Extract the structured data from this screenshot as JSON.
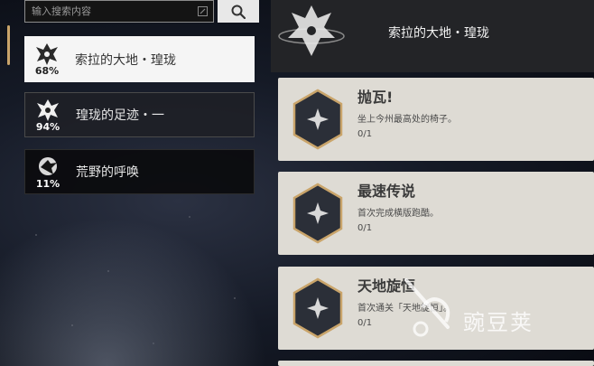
{
  "search": {
    "placeholder": "输入搜索内容"
  },
  "regions": [
    {
      "name": "索拉的大地・瑝珑",
      "percent": "68%",
      "icon": "dragon-head-icon",
      "active": true
    },
    {
      "name": "瑝珑的足迹・一",
      "percent": "94%",
      "icon": "dragon-head-icon",
      "active": false
    },
    {
      "name": "荒野的呼唤",
      "percent": "11%",
      "icon": "bird-emblem-icon",
      "active": false
    }
  ],
  "header": {
    "title": "索拉的大地・瑝珑",
    "emblem": "dragon-emblem-icon"
  },
  "achievements": [
    {
      "title": "抛瓦!",
      "desc": "坐上今州最高处的椅子。",
      "progress": "0/1",
      "icon": "star-badge-icon"
    },
    {
      "title": "最速传说",
      "desc": "首次完成横版跑酷。",
      "progress": "0/1",
      "icon": "star-badge-icon"
    },
    {
      "title": "天地旋恒",
      "desc": "首次通关「天地旋恒」。",
      "progress": "0/1",
      "icon": "star-badge-icon"
    }
  ],
  "watermark": {
    "text": "豌豆荚"
  },
  "colors": {
    "accent": "#c9a46a",
    "card": "#dedbd4",
    "header": "#232427"
  }
}
